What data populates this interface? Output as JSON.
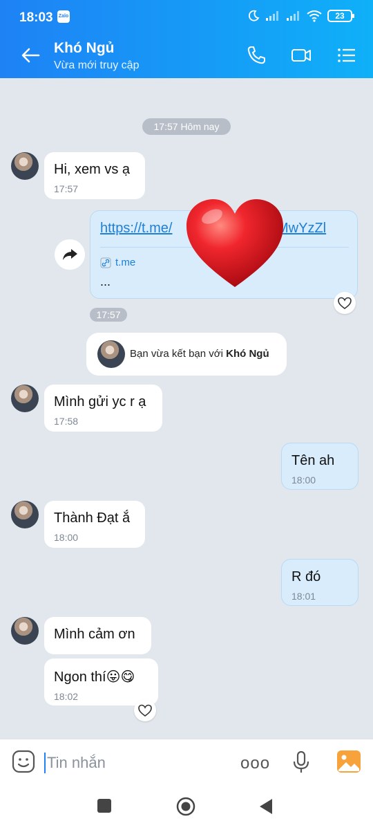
{
  "status": {
    "time": "18:03",
    "app_badge": "Zalo",
    "battery": "23"
  },
  "header": {
    "title": "Khó Ngủ",
    "subtitle": "Vừa mới truy cập"
  },
  "chat": {
    "date_divider": "17:57 Hôm nay",
    "messages": [
      {
        "text": "Hi, xem vs ạ",
        "time": "17:57"
      },
      {
        "text": "Mình gửi yc r ạ",
        "time": "17:58"
      },
      {
        "text": "Tên ah",
        "time": "18:00"
      },
      {
        "text": "Thành Đạt ắ",
        "time": "18:00"
      },
      {
        "text": "R đó",
        "time": "18:01"
      },
      {
        "text": "Mình cảm ơn",
        "time": ""
      },
      {
        "text": "Ngon thí😛😋",
        "time": "18:02"
      }
    ],
    "link": {
      "url_start": "https://t.me/",
      "url_end": "MwYzZl",
      "domain": "t.me",
      "description": "..."
    },
    "link_time": "17:57",
    "friend_note": {
      "prefix": "Bạn vừa kết bạn với",
      "name": "Khó Ngủ"
    }
  },
  "input": {
    "placeholder": "Tin nhắn",
    "more_label": "ooo"
  },
  "colors": {
    "header_start": "#1e82f5",
    "header_end": "#0fb0f8",
    "chat_bg": "#e2e7ee",
    "my_bubble": "#d8ecfb",
    "heart": "#e01d24"
  },
  "icons": [
    "back-arrow-icon",
    "phone-icon",
    "video-icon",
    "menu-list-icon",
    "share-icon",
    "heart-emoji-icon",
    "heart-outline-icon",
    "sticker-icon",
    "microphone-icon",
    "image-icon",
    "link-icon"
  ]
}
